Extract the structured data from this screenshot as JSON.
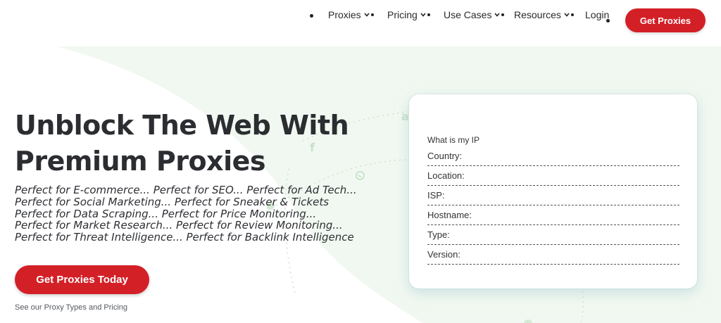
{
  "nav": {
    "items": [
      {
        "label": "Proxies"
      },
      {
        "label": "Pricing"
      },
      {
        "label": "Use Cases"
      },
      {
        "label": "Resources"
      }
    ],
    "login_label": "Login",
    "cta_label": "Get Proxies"
  },
  "hero": {
    "title_line1": "Unblock The Web With",
    "title_line2": "Premium Proxies",
    "taglines": [
      "Perfect for E-commerce... Perfect for SEO... Perfect for Ad Tech...",
      "Perfect for Social Marketing... Perfect for Sneaker & Tickets",
      "Perfect for Data Scraping... Perfect for Price Monitoring...",
      "Perfect for Market Research... Perfect for Review Monitoring...",
      "Perfect for Threat Intelligence... Perfect for Backlink Intelligence"
    ],
    "cta_label": "Get Proxies Today",
    "sub_link": "See our Proxy Types and Pricing"
  },
  "ip_card": {
    "title": "What is my IP",
    "fields": [
      {
        "label": "Country:"
      },
      {
        "label": "Location:"
      },
      {
        "label": "ISP:"
      },
      {
        "label": "Hostname:"
      },
      {
        "label": "Type:"
      },
      {
        "label": "Version:"
      }
    ]
  },
  "icons": [
    "chevron-down-icon",
    "facebook-icon",
    "whatsapp-icon",
    "amazon-icon"
  ],
  "colors": {
    "brand_red": "#d32027",
    "bg_green": "#eef7ee",
    "text_dark": "#2b2d31"
  }
}
